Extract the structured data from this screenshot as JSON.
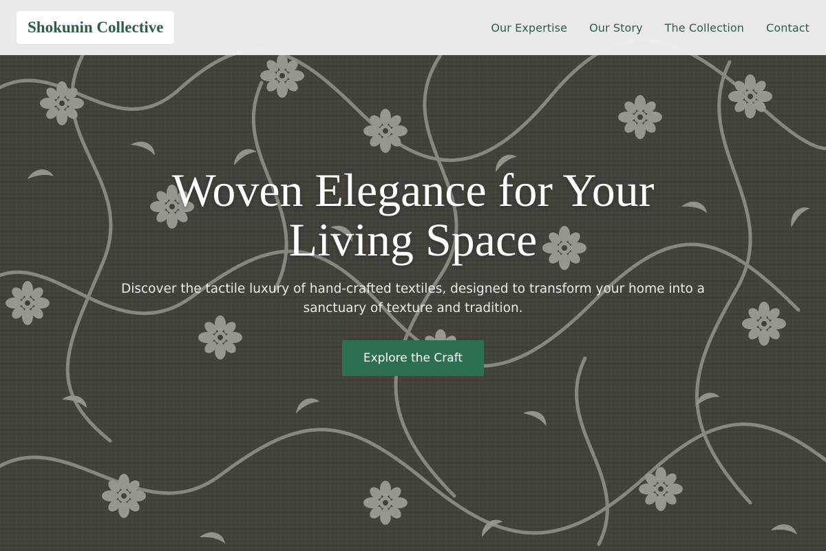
{
  "brand": {
    "name": "Shokunin Collective",
    "accent": "#2c7050",
    "text_color": "#2c5e44"
  },
  "nav": {
    "items": [
      {
        "label": "Our Expertise"
      },
      {
        "label": "Our Story"
      },
      {
        "label": "The Collection"
      },
      {
        "label": "Contact"
      }
    ]
  },
  "hero": {
    "title": "Woven Elegance for Your Living Space",
    "subtitle": "Discover the tactile luxury of hand-crafted textiles, designed to transform your home into a sanctuary of texture and tradition.",
    "cta_label": "Explore the Craft",
    "background_icon": "floral-textile-pattern",
    "background_color": "#4b4741",
    "pattern_color": "#bdbbb5"
  }
}
